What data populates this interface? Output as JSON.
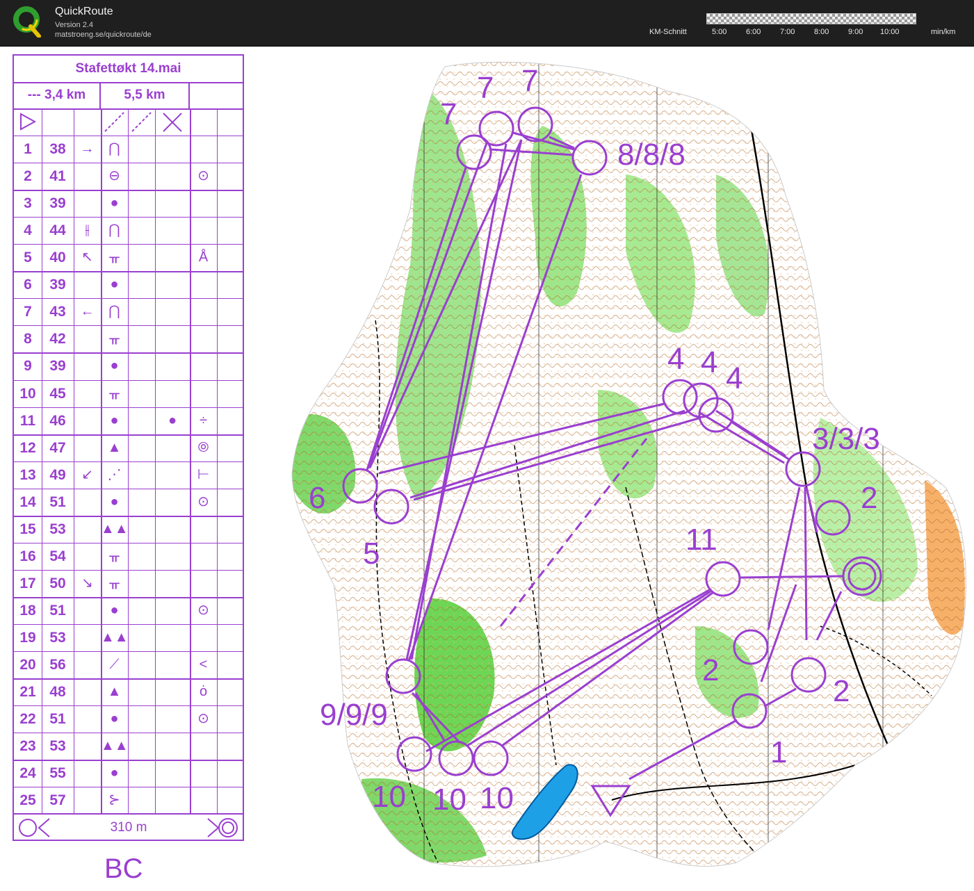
{
  "app": {
    "title": "QuickRoute",
    "version": "Version 2.4",
    "url": "matstroeng.se/quickroute/de"
  },
  "pace_legend": {
    "label": "KM-Schnitt",
    "ticks": [
      "5:00",
      "6:00",
      "7:00",
      "8:00",
      "9:00",
      "10:00"
    ],
    "unit": "min/km"
  },
  "description_sheet": {
    "title": "Stafettøkt 14.mai",
    "length_a": "--- 3,4 km",
    "length_b": "5,5 km",
    "distance_to_finish": "310 m",
    "rows": [
      {
        "n": "1",
        "code": "38",
        "c": "→",
        "d": "⋂",
        "f": "",
        "h": ""
      },
      {
        "n": "2",
        "code": "41",
        "c": "",
        "d": "⊖",
        "f": "",
        "h": "⊙"
      },
      {
        "n": "3",
        "code": "39",
        "c": "",
        "d": "●",
        "f": "",
        "h": ""
      },
      {
        "n": "4",
        "code": "44",
        "c": "⫲",
        "d": "⋂",
        "f": "",
        "h": ""
      },
      {
        "n": "5",
        "code": "40",
        "c": "↖",
        "d": "ᚂ",
        "f": "",
        "h": "Å"
      },
      {
        "n": "6",
        "code": "39",
        "c": "",
        "d": "●",
        "f": "",
        "h": ""
      },
      {
        "n": "7",
        "code": "43",
        "c": "←",
        "d": "⋂",
        "f": "",
        "h": ""
      },
      {
        "n": "8",
        "code": "42",
        "c": "",
        "d": "ᚂ",
        "f": "",
        "h": ""
      },
      {
        "n": "9",
        "code": "39",
        "c": "",
        "d": "●",
        "f": "",
        "h": ""
      },
      {
        "n": "10",
        "code": "45",
        "c": "",
        "d": "ᚂ",
        "f": "",
        "h": ""
      },
      {
        "n": "11",
        "code": "46",
        "c": "",
        "d": "●",
        "f": "●",
        "h": "÷"
      },
      {
        "n": "12",
        "code": "47",
        "c": "",
        "d": "▲",
        "f": "",
        "h": "⦾"
      },
      {
        "n": "13",
        "code": "49",
        "c": "↙",
        "d": "⋰",
        "f": "",
        "h": "⊢"
      },
      {
        "n": "14",
        "code": "51",
        "c": "",
        "d": "●",
        "f": "",
        "h": "⊙"
      },
      {
        "n": "15",
        "code": "53",
        "c": "",
        "d": "▲▲",
        "f": "",
        "h": ""
      },
      {
        "n": "16",
        "code": "54",
        "c": "",
        "d": "ᚂ",
        "f": "",
        "h": ""
      },
      {
        "n": "17",
        "code": "50",
        "c": "↘",
        "d": "ᚂ",
        "f": "",
        "h": ""
      },
      {
        "n": "18",
        "code": "51",
        "c": "",
        "d": "●",
        "f": "",
        "h": "⊙"
      },
      {
        "n": "19",
        "code": "53",
        "c": "",
        "d": "▲▲",
        "f": "",
        "h": ""
      },
      {
        "n": "20",
        "code": "56",
        "c": "",
        "d": "⟋",
        "f": "",
        "h": "<"
      },
      {
        "n": "21",
        "code": "48",
        "c": "",
        "d": "▲",
        "f": "",
        "h": "ȯ"
      },
      {
        "n": "22",
        "code": "51",
        "c": "",
        "d": "●",
        "f": "",
        "h": "⊙"
      },
      {
        "n": "23",
        "code": "53",
        "c": "",
        "d": "▲▲",
        "f": "",
        "h": ""
      },
      {
        "n": "24",
        "code": "55",
        "c": "",
        "d": "●",
        "f": "",
        "h": ""
      },
      {
        "n": "25",
        "code": "57",
        "c": "",
        "d": "⊱",
        "f": "",
        "h": ""
      }
    ]
  },
  "map": {
    "course_color": "#9a3fd0",
    "control_labels": [
      "7",
      "7",
      "7",
      "8/8/8",
      "4",
      "4",
      "4",
      "3/3/3",
      "2",
      "6",
      "5",
      "11",
      "2",
      "2",
      "1",
      "9/9/9",
      "10",
      "10",
      "10"
    ],
    "start_symbol": "triangle",
    "lake_color": "#1ea0e6"
  },
  "footer_label": "BC"
}
